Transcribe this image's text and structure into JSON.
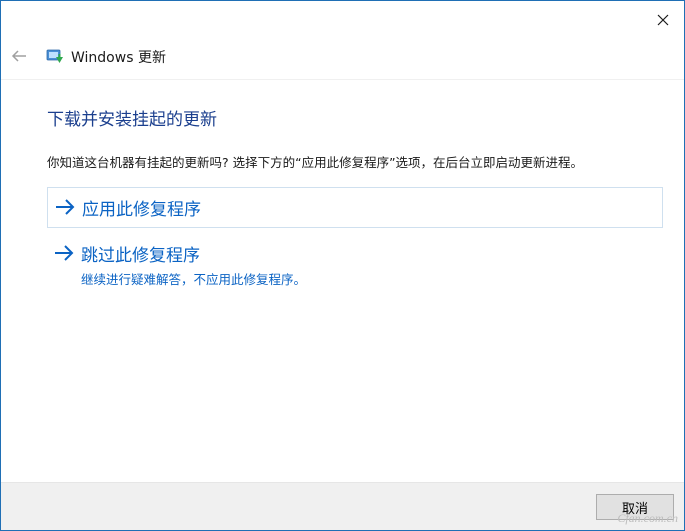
{
  "window": {
    "title": "Windows 更新"
  },
  "icons": {
    "back": "back-arrow-icon",
    "app": "windows-update-icon",
    "close": "close-icon",
    "option_arrow": "right-arrow-icon"
  },
  "main": {
    "heading": "下载并安装挂起的更新",
    "description": "你知道这台机器有挂起的更新吗? 选择下方的“应用此修复程序”选项，在后台立即启动更新进程。",
    "options": [
      {
        "label": "应用此修复程序"
      },
      {
        "label": "跳过此修复程序",
        "sublabel": "继续进行疑难解答，不应用此修复程序。"
      }
    ]
  },
  "footer": {
    "cancel_label": "取消"
  },
  "watermark": "Cfan.com.cn",
  "colors": {
    "heading": "#1b3f8e",
    "link": "#0b63c4",
    "window_border": "#1f6fb5",
    "footer_bg": "#f0f0f0",
    "option_border": "#cfe0ef"
  }
}
